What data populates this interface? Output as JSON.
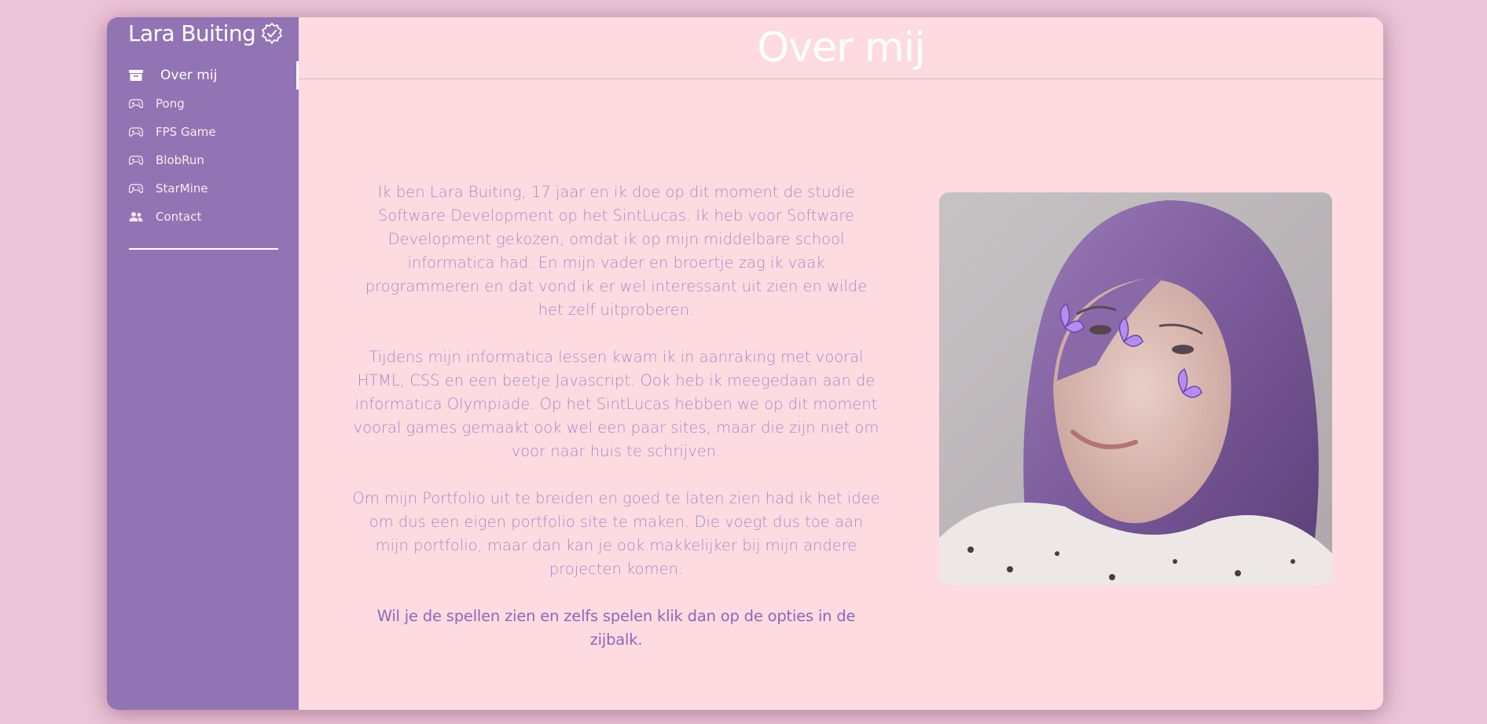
{
  "sidebar": {
    "brand": "Lara Buiting",
    "badge_icon": "verified-check-icon",
    "items": [
      {
        "label": "Over mij",
        "icon": "archive-icon",
        "active": true
      },
      {
        "label": "Pong",
        "icon": "gamepad-icon"
      },
      {
        "label": "FPS Game",
        "icon": "gamepad-icon"
      },
      {
        "label": "BlobRun",
        "icon": "gamepad-icon"
      },
      {
        "label": "StarMine",
        "icon": "gamepad-icon"
      },
      {
        "label": "Contact",
        "icon": "users-icon"
      }
    ]
  },
  "header": {
    "title": "Over mij"
  },
  "content": {
    "paragraphs": [
      "Ik ben Lara Buiting, 17 jaar en ik doe op dit moment de studie Software Development op het SintLucas. Ik heb voor Software Development gekozen, omdat ik op mijn middelbare school informatica had. En mijn vader en broertje zag ik vaak programmeren en dat vond ik er wel interessant uit zien en wilde het zelf uitproberen.",
      "Tijdens mijn informatica lessen kwam ik in aanraking met vooral HTML, CSS en een beetje Javascript. Ook heb ik meegedaan aan de informatica Olympiade. Op het SintLucas hebben we op dit moment vooral games gemaakt ook wel een paar sites, maar die zijn niet om voor naar huis te schrijven.",
      "Om mijn Portfolio uit te breiden en goed te laten zien had ik het idee om dus een eigen portfolio site te maken. Die voegt dus toe aan mijn portfolio, maar dan kan je ook makkelijker bij mijn andere projecten komen."
    ],
    "cta": "Wil je de spellen zien en zelfs spelen klik dan op de opties in de zijbalk."
  },
  "colors": {
    "sidebar": "#9274b4",
    "main_bg": "#fedbe1",
    "page_bg": "#ecc4d8",
    "text": "#a58bc2",
    "accent": "#8c68b6"
  }
}
